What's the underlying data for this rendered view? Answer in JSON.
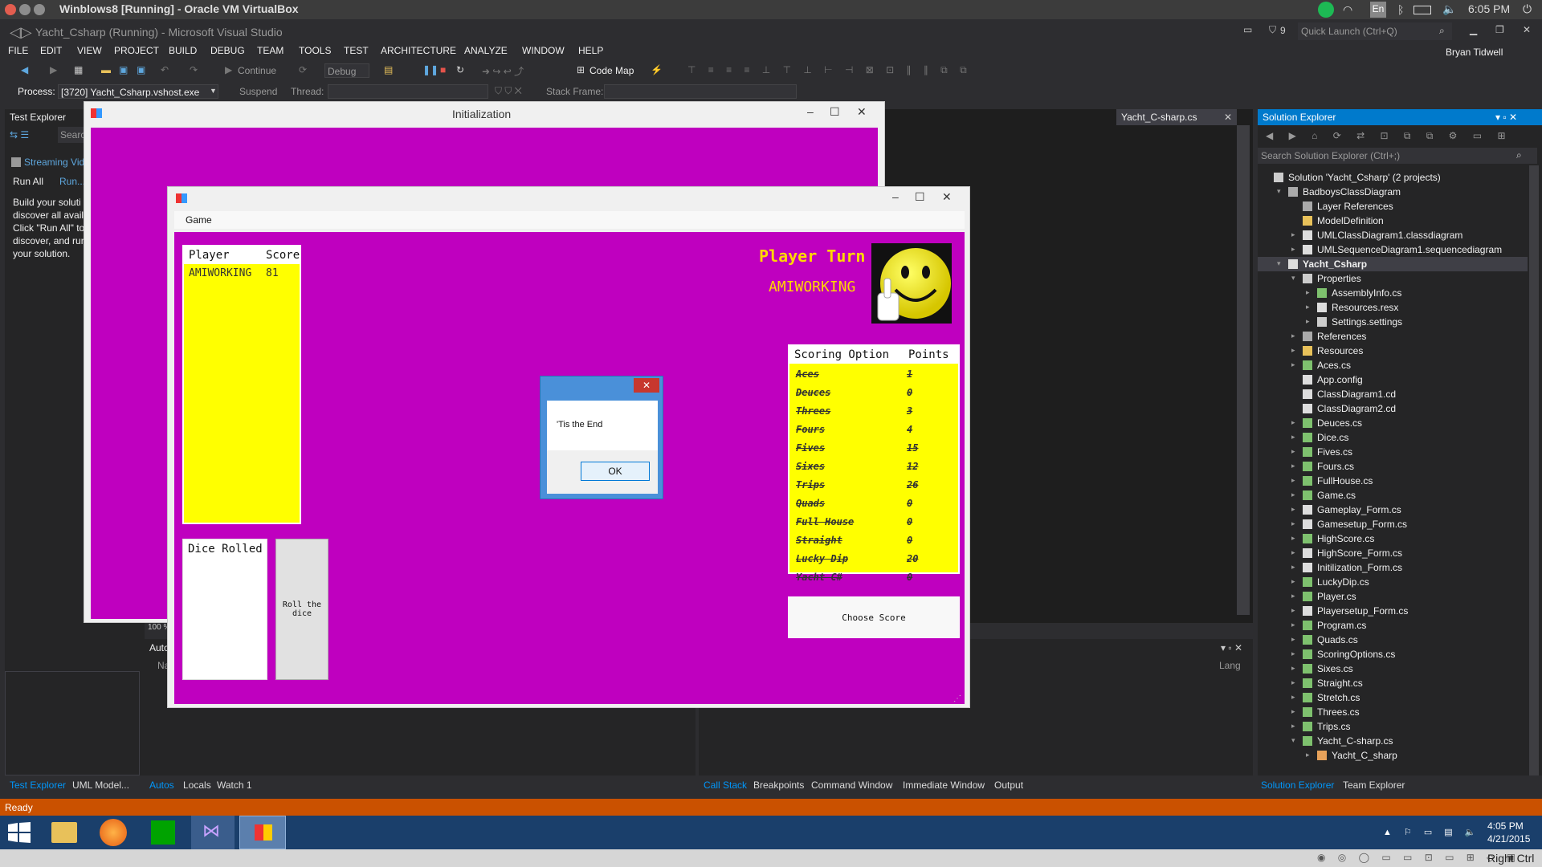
{
  "host": {
    "title": "Winblows8 [Running] - Oracle VM VirtualBox",
    "clock": "6:05 PM",
    "lang": "En",
    "bottom_label": "Right Ctrl"
  },
  "vs": {
    "title": "Yacht_Csharp (Running) - Microsoft Visual Studio",
    "notif_count": "9",
    "quick_launch": "Quick Launch (Ctrl+Q)",
    "user": "Bryan Tidwell",
    "menu": [
      "FILE",
      "EDIT",
      "VIEW",
      "PROJECT",
      "BUILD",
      "DEBUG",
      "TEAM",
      "TOOLS",
      "TEST",
      "ARCHITECTURE",
      "ANALYZE",
      "WINDOW",
      "HELP"
    ],
    "toolbar": {
      "continue": "Continue",
      "config": "Debug",
      "codemap": "Code Map"
    },
    "toolbar2": {
      "process_label": "Process:",
      "process_value": "[3720] Yacht_Csharp.vshost.exe",
      "suspend": "Suspend",
      "thread": "Thread:",
      "stack": "Stack Frame:"
    },
    "status": "Ready"
  },
  "test_explorer": {
    "title": "Test Explorer",
    "search": "Searc",
    "streaming": "Streaming Vid",
    "run_all": "Run All",
    "run": "Run...",
    "desc": [
      "Build your soluti",
      "discover all avail",
      "Click \"Run All\" to",
      "discover, and run",
      "your solution."
    ],
    "bottom_tabs": [
      "Test Explorer",
      "UML Model..."
    ]
  },
  "editor": {
    "tab": "Yacht_C-sharp.cs",
    "zoom": "100 %"
  },
  "autos": {
    "title": "Auto",
    "col": "Na",
    "lang_col": "Lang",
    "tabs": [
      "Autos",
      "Locals",
      "Watch 1"
    ]
  },
  "callstack": {
    "tabs": [
      "Call Stack",
      "Breakpoints",
      "Command Window",
      "Immediate Window",
      "Output"
    ]
  },
  "solution": {
    "title": "Solution Explorer",
    "search": "Search Solution Explorer (Ctrl+;)",
    "bottom_tabs": [
      "Solution Explorer",
      "Team Explorer"
    ],
    "items": [
      "Solution 'Yacht_Csharp' (2 projects)",
      "BadboysClassDiagram",
      "Layer References",
      "ModelDefinition",
      "UMLClassDiagram1.classdiagram",
      "UMLSequenceDiagram1.sequencediagram",
      "Yacht_Csharp",
      "Properties",
      "AssemblyInfo.cs",
      "Resources.resx",
      "Settings.settings",
      "References",
      "Resources",
      "Aces.cs",
      "App.config",
      "ClassDiagram1.cd",
      "ClassDiagram2.cd",
      "Deuces.cs",
      "Dice.cs",
      "Fives.cs",
      "Fours.cs",
      "FullHouse.cs",
      "Game.cs",
      "Gameplay_Form.cs",
      "Gamesetup_Form.cs",
      "HighScore.cs",
      "HighScore_Form.cs",
      "Initilization_Form.cs",
      "LuckyDip.cs",
      "Player.cs",
      "Playersetup_Form.cs",
      "Program.cs",
      "Quads.cs",
      "ScoringOptions.cs",
      "Sixes.cs",
      "Straight.cs",
      "Stretch.cs",
      "Threes.cs",
      "Trips.cs",
      "Yacht_C-sharp.cs",
      "Yacht_C_sharp"
    ]
  },
  "init_window": {
    "title": "Initialization"
  },
  "game_window": {
    "menu": "Game",
    "players_header": {
      "player": "Player",
      "score": "Score"
    },
    "players": [
      {
        "name": "AMIWORKING",
        "score": "81"
      }
    ],
    "player_turn_label": "Player Turn",
    "current_player": "AMIWORKING",
    "dice_label": "Dice Rolled",
    "roll_button": "Roll the dice",
    "scoring_header": {
      "option": "Scoring Option",
      "points": "Points"
    },
    "scoring": [
      {
        "option": "Aces",
        "points": "1"
      },
      {
        "option": "Deuces",
        "points": "0"
      },
      {
        "option": "Threes",
        "points": "3"
      },
      {
        "option": "Fours",
        "points": "4"
      },
      {
        "option": "Fives",
        "points": "15"
      },
      {
        "option": "Sixes",
        "points": "12"
      },
      {
        "option": "Trips",
        "points": "26"
      },
      {
        "option": "Quads",
        "points": "0"
      },
      {
        "option": "Full House",
        "points": "0"
      },
      {
        "option": "Straight",
        "points": "0"
      },
      {
        "option": "Lucky Dip",
        "points": "20"
      },
      {
        "option": "Yacht C#",
        "points": "0"
      }
    ],
    "choose_button": "Choose Score"
  },
  "dialog": {
    "message": "'Tis the End",
    "ok": "OK"
  },
  "taskbar": {
    "time": "4:05 PM",
    "date": "4/21/2015"
  },
  "colors": {
    "vs_blue": "#007acc",
    "status_orange": "#ca5100",
    "magenta": "#bf00bf",
    "yellow": "#ffff00"
  }
}
